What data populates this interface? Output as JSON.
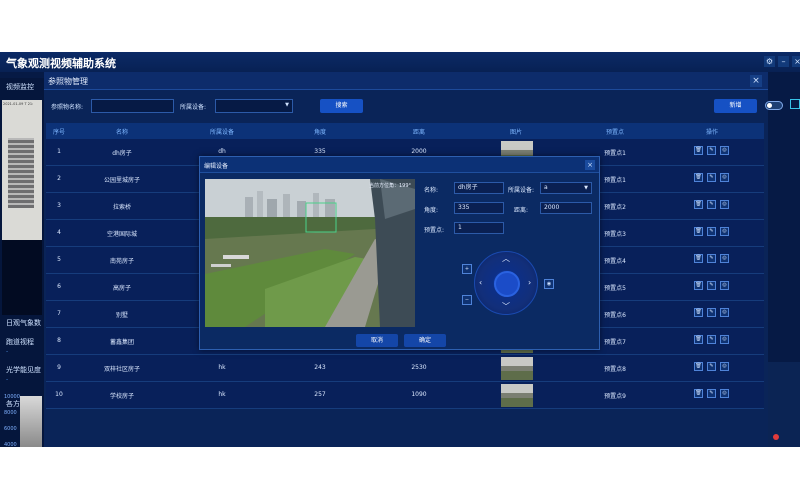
{
  "app": {
    "title": "气象观测视频辅助系统"
  },
  "sidebar": {
    "top_label": "视频监控",
    "video_timestamp": "2021-01-09 T 21:",
    "items": [
      "日观气象数",
      "跑道视程",
      "光学能见度",
      "各方位能见"
    ],
    "chart_ticks": [
      "10000",
      "8000",
      "6000",
      "4000"
    ]
  },
  "panel": {
    "title": "参照物管理",
    "close_label": "×",
    "search": {
      "name_label": "参照物名称:",
      "name_value": "",
      "device_label": "所属设备:",
      "device_value": "",
      "search_button": "搜索",
      "add_button": "新增"
    },
    "columns": [
      "序号",
      "名称",
      "所属设备",
      "角度",
      "距离",
      "图片",
      "预置点",
      "操作"
    ],
    "rows": [
      {
        "index": "1",
        "name": "dh房子",
        "device": "dh",
        "angle": "335",
        "distance": "2000",
        "preset": "预置点1",
        "has_image": true
      },
      {
        "index": "2",
        "name": "公园里城房子",
        "device": "",
        "angle": "",
        "distance": "",
        "preset": "预置点1",
        "has_image": false
      },
      {
        "index": "3",
        "name": "拉索桥",
        "device": "",
        "angle": "",
        "distance": "",
        "preset": "预置点2",
        "has_image": false
      },
      {
        "index": "4",
        "name": "空港国际城",
        "device": "",
        "angle": "",
        "distance": "",
        "preset": "预置点3",
        "has_image": false
      },
      {
        "index": "5",
        "name": "南苑房子",
        "device": "",
        "angle": "",
        "distance": "",
        "preset": "预置点4",
        "has_image": false
      },
      {
        "index": "6",
        "name": "高房子",
        "device": "",
        "angle": "",
        "distance": "",
        "preset": "预置点5",
        "has_image": false
      },
      {
        "index": "7",
        "name": "别墅",
        "device": "",
        "angle": "",
        "distance": "",
        "preset": "预置点6",
        "has_image": false
      },
      {
        "index": "8",
        "name": "蓄鑫集团",
        "device": "",
        "angle": "",
        "distance": "",
        "preset": "预置点7",
        "has_image": true
      },
      {
        "index": "9",
        "name": "双梓社区房子",
        "device": "hk",
        "angle": "243",
        "distance": "2530",
        "preset": "预置点8",
        "has_image": true
      },
      {
        "index": "10",
        "name": "学校房子",
        "device": "hk",
        "angle": "257",
        "distance": "1090",
        "preset": "预置点9",
        "has_image": true
      }
    ]
  },
  "dialog": {
    "title": "编辑设备",
    "close_label": "×",
    "camera_overlay": "当前方位角：199°",
    "name_label": "名称:",
    "name_value": "dh房子",
    "device_label": "所属设备:",
    "device_value": "a",
    "angle_label": "角度:",
    "angle_value": "335",
    "distance_label": "距离:",
    "distance_value": "2000",
    "preset_label": "预置点:",
    "preset_value": "1",
    "cancel_button": "取消",
    "confirm_button": "确定"
  }
}
